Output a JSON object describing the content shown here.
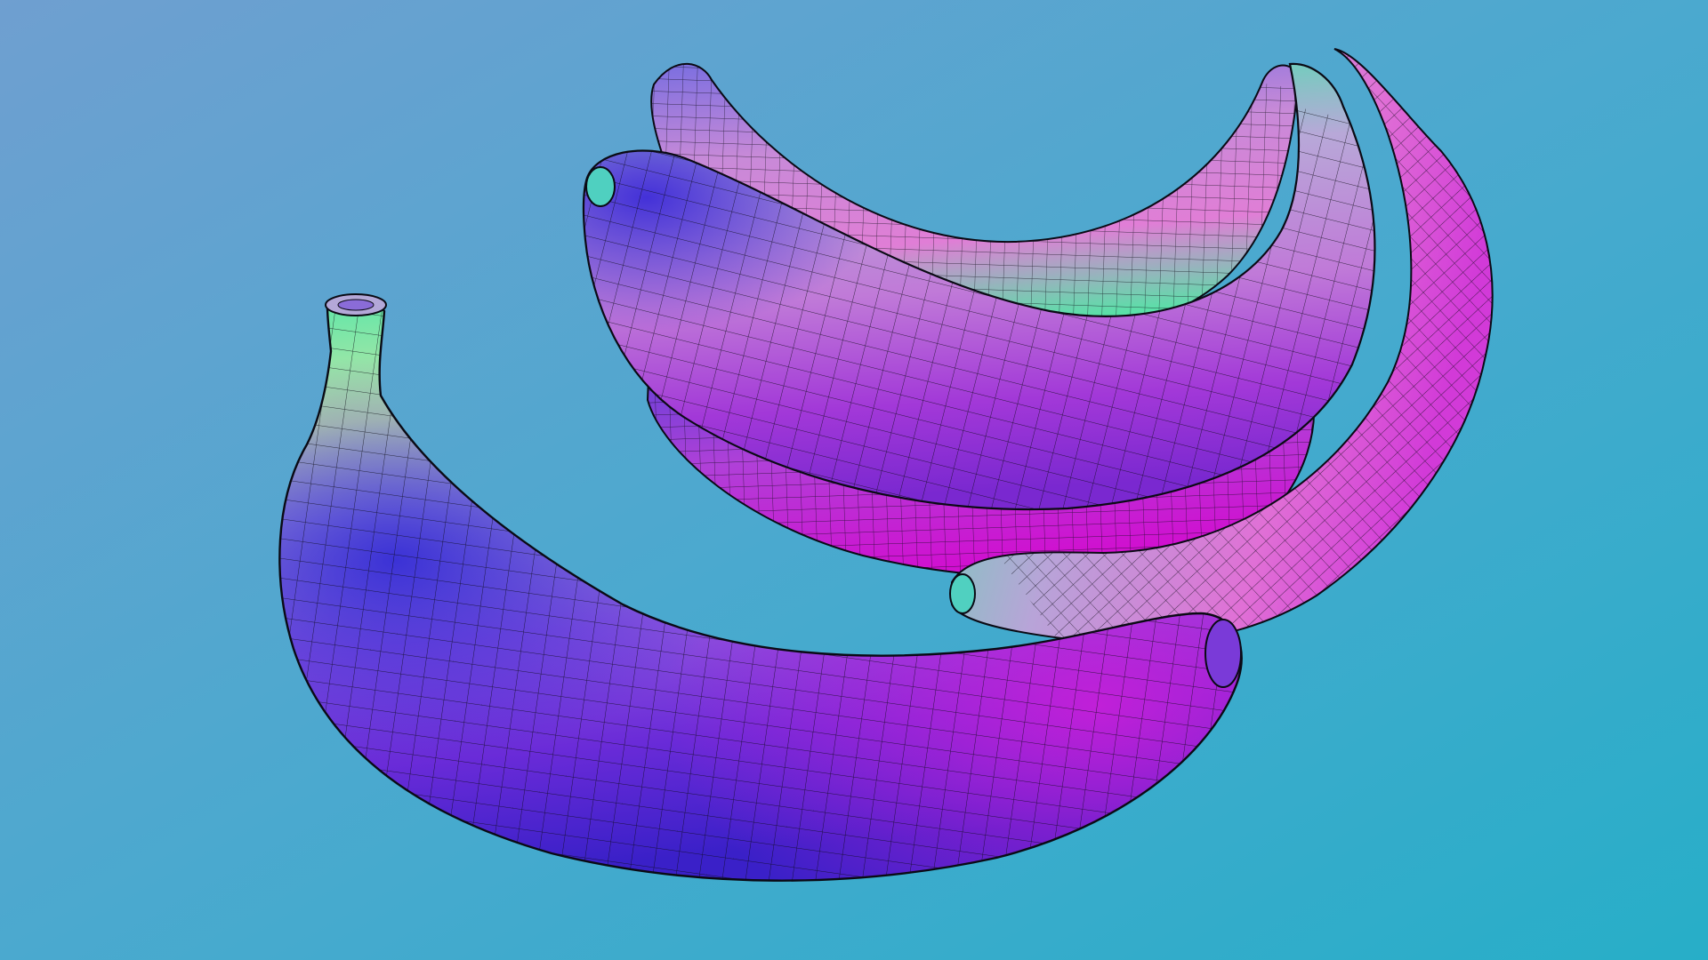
{
  "scene": {
    "subject": "banana-bunch",
    "banana_count": 5,
    "render_style": "wireframe-normal-map",
    "background": {
      "top_left": "#6f9fd0",
      "top_right": "#2a9fd0",
      "bottom_left": "#67b4cc",
      "bottom_right": "#27aec8"
    },
    "surface_palette": {
      "green": "#54e6a0",
      "yellow": "#cfe7a0",
      "lavender": "#a8a6d8",
      "pink": "#e07ed6",
      "magenta": "#c000d0",
      "violet": "#6a2bd8",
      "blue": "#2f28d6",
      "cyan": "#24b8d4"
    },
    "wire_color": "#0a0a14"
  }
}
